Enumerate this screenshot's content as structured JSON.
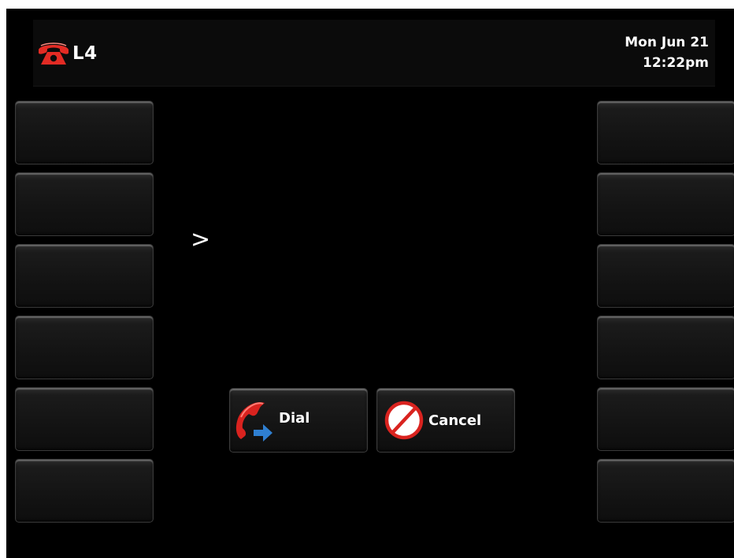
{
  "status_bar": {
    "line_label": "L4",
    "line_icon": "red-handset-icon",
    "date": "Mon Jun 21",
    "time": "12:22pm"
  },
  "softkeys": {
    "left_count": 6,
    "right_count": 6
  },
  "dial_prompt": {
    "text": ">"
  },
  "actions": {
    "dial_label": "Dial",
    "dial_icon": "dial-handset-arrow-icon",
    "cancel_label": "Cancel",
    "cancel_icon": "cancel-prohibited-icon"
  },
  "colors": {
    "background": "#000000",
    "accent_red": "#d9231f",
    "arrow_blue": "#2f7fd1",
    "text": "#ffffff"
  }
}
